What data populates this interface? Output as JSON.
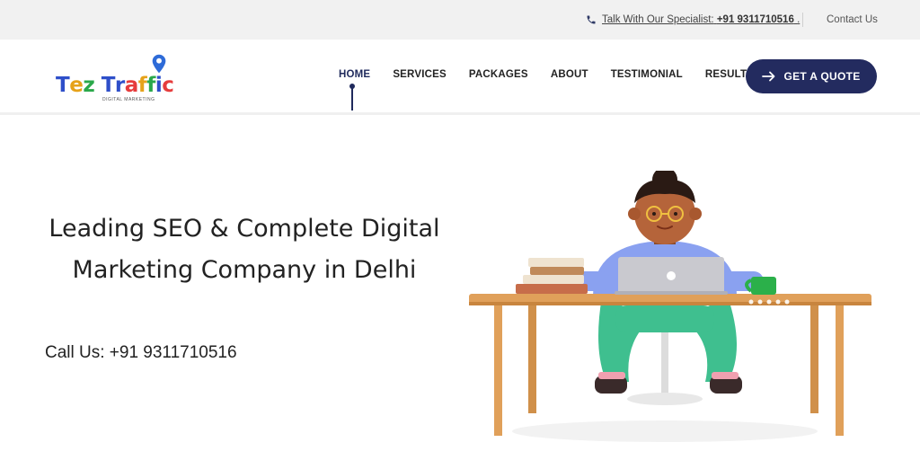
{
  "topbar": {
    "specialist_prefix": "Talk With Our Specialist:",
    "specialist_phone": "+91 9311710516",
    "specialist_suffix": ".",
    "contact_label": "Contact Us"
  },
  "logo": {
    "brand_letters": [
      "T",
      "e",
      "z",
      " ",
      "T",
      "r",
      "a",
      "f",
      "f",
      "i",
      "c"
    ],
    "brand_colors": [
      "#2e4fc9",
      "#e6a21a",
      "#2aa84a",
      "#ffffff",
      "#2e4fc9",
      "#2e4fc9",
      "#e63c3c",
      "#e6a21a",
      "#2aa84a",
      "#2e4fc9",
      "#e63c3c"
    ],
    "tagline": "DIGITAL MARKETING",
    "pin_color": "#2e6bd8"
  },
  "nav": {
    "items": [
      {
        "label": "HOME",
        "active": true
      },
      {
        "label": "SERVICES",
        "active": false
      },
      {
        "label": "PACKAGES",
        "active": false
      },
      {
        "label": "ABOUT",
        "active": false
      },
      {
        "label": "TESTIMONIAL",
        "active": false
      },
      {
        "label": "RESULTS",
        "active": false
      }
    ],
    "cta_label": "GET A QUOTE",
    "accent": "#232b5f"
  },
  "hero": {
    "title": "Leading SEO & Complete Digital Marketing Company in Delhi",
    "call_text": "Call Us: +91 9311710516"
  },
  "colors": {
    "topbar_bg": "#f1f1f1",
    "desk": "#e0a05a",
    "shirt": "#8aa1f0",
    "pants": "#3fbf8f"
  }
}
